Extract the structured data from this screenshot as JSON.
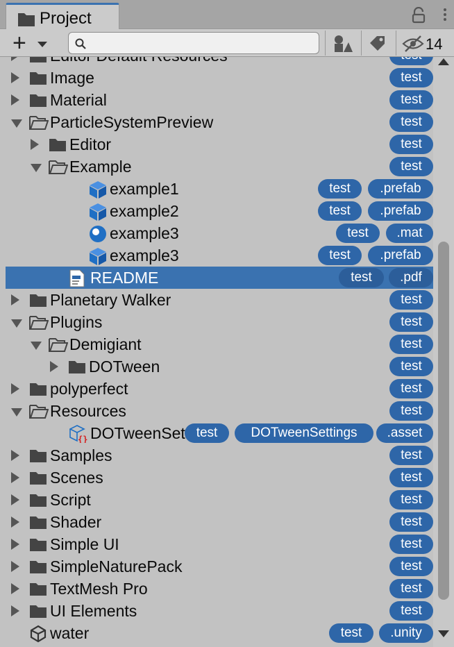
{
  "tab": {
    "title": "Project"
  },
  "toolbar": {
    "search_placeholder": "",
    "hidden_count": "14"
  },
  "colors": {
    "selection": "#3a72b0",
    "badge": "#2e66a8",
    "prefab_icon": "#1f6fc4"
  },
  "tree": [
    {
      "name": "Editor Default Resources",
      "icon": "folder-icon",
      "arrow": "collapsed",
      "badges": [
        "test"
      ]
    },
    {
      "name": "Image",
      "icon": "folder-icon",
      "arrow": "collapsed",
      "badges": [
        "test"
      ]
    },
    {
      "name": "Material",
      "icon": "folder-icon",
      "arrow": "collapsed",
      "badges": [
        "test"
      ]
    },
    {
      "name": "ParticleSystemPreview",
      "icon": "folder-open-icon",
      "arrow": "expanded",
      "badges": [
        "test"
      ]
    },
    {
      "name": "Editor",
      "icon": "folder-icon",
      "arrow": "collapsed",
      "badges": [
        "test"
      ]
    },
    {
      "name": "Example",
      "icon": "folder-open-icon",
      "arrow": "expanded",
      "badges": [
        "test"
      ]
    },
    {
      "name": "example1",
      "icon": "prefab-cube-icon",
      "arrow": "none",
      "badges": [
        "test",
        ".prefab"
      ]
    },
    {
      "name": "example2",
      "icon": "prefab-cube-icon",
      "arrow": "none",
      "badges": [
        "test",
        ".prefab"
      ]
    },
    {
      "name": "example3",
      "icon": "material-sphere-icon",
      "arrow": "none",
      "badges": [
        "test",
        ".mat"
      ]
    },
    {
      "name": "example3",
      "icon": "prefab-cube-icon",
      "arrow": "none",
      "badges": [
        "test",
        ".prefab"
      ]
    },
    {
      "name": "README",
      "icon": "pdf-document-icon",
      "arrow": "none",
      "badges": [
        "test",
        ".pdf"
      ],
      "selected": true
    },
    {
      "name": "Planetary Walker",
      "icon": "folder-icon",
      "arrow": "collapsed",
      "badges": [
        "test"
      ]
    },
    {
      "name": "Plugins",
      "icon": "folder-open-icon",
      "arrow": "expanded",
      "badges": [
        "test"
      ]
    },
    {
      "name": "Demigiant",
      "icon": "folder-open-icon",
      "arrow": "expanded",
      "badges": [
        "test"
      ]
    },
    {
      "name": "DOTween",
      "icon": "folder-icon",
      "arrow": "collapsed",
      "badges": [
        "test"
      ]
    },
    {
      "name": "polyperfect",
      "icon": "folder-icon",
      "arrow": "collapsed",
      "badges": [
        "test"
      ]
    },
    {
      "name": "Resources",
      "icon": "folder-open-icon",
      "arrow": "expanded",
      "badges": [
        "test"
      ]
    },
    {
      "name": "DOTweenSettings",
      "icon": "scriptable-asset-icon",
      "arrow": "none",
      "badges": [
        "test",
        "DOTweenSettings",
        ".asset"
      ]
    },
    {
      "name": "Samples",
      "icon": "folder-icon",
      "arrow": "collapsed",
      "badges": [
        "test"
      ]
    },
    {
      "name": "Scenes",
      "icon": "folder-icon",
      "arrow": "collapsed",
      "badges": [
        "test"
      ]
    },
    {
      "name": "Script",
      "icon": "folder-icon",
      "arrow": "collapsed",
      "badges": [
        "test"
      ]
    },
    {
      "name": "Shader",
      "icon": "folder-icon",
      "arrow": "collapsed",
      "badges": [
        "test"
      ]
    },
    {
      "name": "Simple UI",
      "icon": "folder-icon",
      "arrow": "collapsed",
      "badges": [
        "test"
      ]
    },
    {
      "name": "SimpleNaturePack",
      "icon": "folder-icon",
      "arrow": "collapsed",
      "badges": [
        "test"
      ]
    },
    {
      "name": "TextMesh Pro",
      "icon": "folder-icon",
      "arrow": "collapsed",
      "badges": [
        "test"
      ]
    },
    {
      "name": "UI Elements",
      "icon": "folder-icon",
      "arrow": "collapsed",
      "badges": [
        "test"
      ]
    },
    {
      "name": "water",
      "icon": "unity-scene-icon",
      "arrow": "none",
      "badges": [
        "test",
        ".unity"
      ]
    }
  ]
}
